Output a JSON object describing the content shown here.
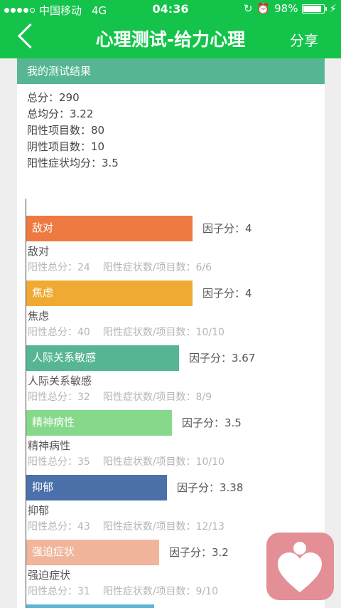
{
  "status_bar": {
    "carrier": "中国移动",
    "network": "4G",
    "time": "04:36",
    "battery": "98%",
    "battery_level": 0.98
  },
  "nav": {
    "title": "心理测试-给力心理",
    "share": "分享"
  },
  "results": {
    "header": "我的测试结果",
    "summary": [
      "总分：290",
      "总均分：3.22",
      "阳性项目数：80",
      "阴性项目数：10",
      "阳性症状均分：3.5"
    ]
  },
  "chart_data": {
    "type": "bar",
    "categories": [
      "敌对",
      "焦虑",
      "人际关系敏感",
      "精神病性",
      "抑郁",
      "强迫症状"
    ],
    "values": [
      4,
      4,
      3.67,
      3.5,
      3.38,
      3.2
    ],
    "score_labels": [
      "因子分：4",
      "因子分：4",
      "因子分：3.67",
      "因子分：3.5",
      "因子分：3.38",
      "因子分：3.2"
    ],
    "details": [
      {
        "total": "阳性总分：24",
        "count": "阳性症状数/项目数：6/6"
      },
      {
        "total": "阳性总分：40",
        "count": "阳性症状数/项目数：10/10"
      },
      {
        "total": "阳性总分：32",
        "count": "阳性症状数/项目数：8/9"
      },
      {
        "total": "阳性总分：35",
        "count": "阳性症状数/项目数：10/10"
      },
      {
        "total": "阳性总分：43",
        "count": "阳性症状数/项目数：12/13"
      },
      {
        "total": "阳性总分：31",
        "count": "阳性症状数/项目数：9/10"
      }
    ],
    "colors": [
      "#ee7a41",
      "#efaa33",
      "#56b693",
      "#86d98a",
      "#4b70aa",
      "#f0b59b"
    ],
    "xlim": [
      0,
      5
    ]
  },
  "fab": {
    "icon": "heart-person-icon",
    "color": "#e38f95"
  }
}
